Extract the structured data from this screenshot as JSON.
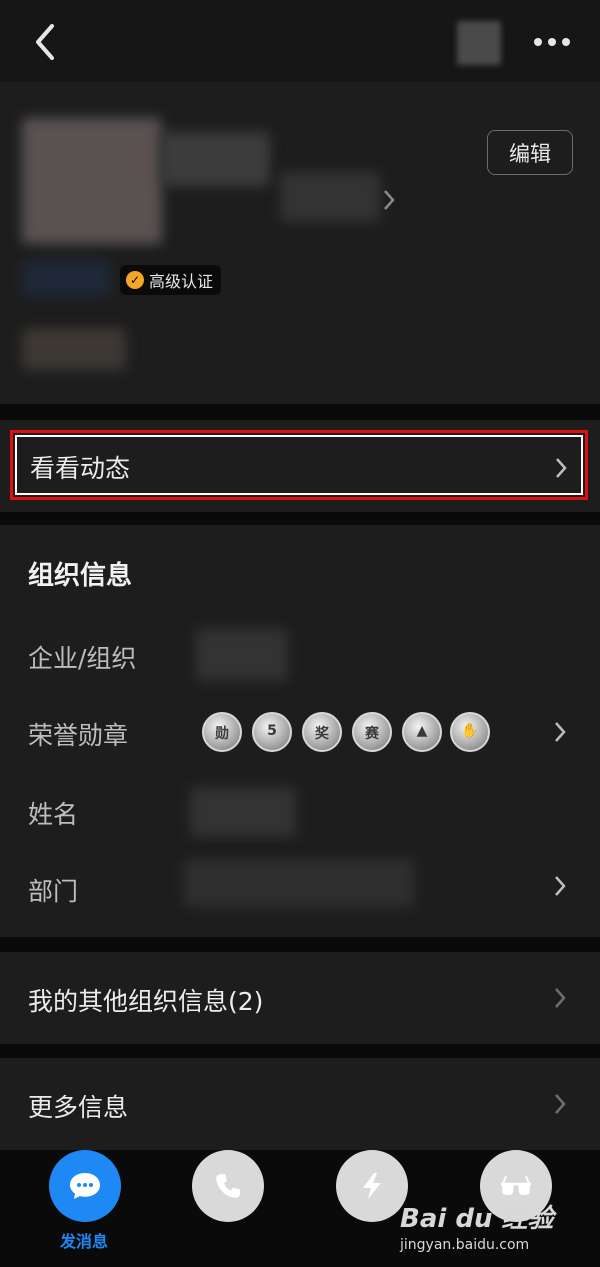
{
  "header": {
    "back_icon": "chevron-left-icon",
    "more_icon": "more-dots-icon"
  },
  "profile": {
    "edit_label": "编辑",
    "verify_badge": "高级认证",
    "verify_check": "✓"
  },
  "feed": {
    "label": "看看动态"
  },
  "org_info": {
    "title": "组织信息",
    "rows": [
      {
        "label": "企业/组织"
      },
      {
        "label": "荣誉勋章"
      },
      {
        "label": "姓名"
      },
      {
        "label": "部门"
      }
    ],
    "medals": [
      "勋",
      "5",
      "奖",
      "赛",
      "▲",
      "✋"
    ]
  },
  "other_org": {
    "label": "我的其他组织信息(2)"
  },
  "more_info": {
    "label": "更多信息"
  },
  "actions": {
    "message_label": "发消息",
    "message_icon": "chat-bubble-icon",
    "call_icon": "phone-icon",
    "ding_icon": "lightning-icon",
    "view_icon": "glasses-icon"
  },
  "watermark": {
    "brand": "Bai du 经验",
    "url": "jingyan.baidu.com"
  }
}
